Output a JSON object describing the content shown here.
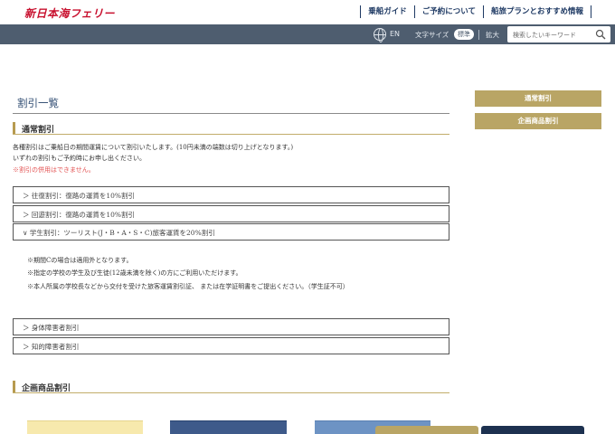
{
  "header": {
    "logo": "新日本海フェリー",
    "nav": [
      "乗船ガイド",
      "ご予約について",
      "船旅プランとおすすめ情報"
    ],
    "lang": "EN",
    "font_size_label": "文字サイズ",
    "font_standard": "標準",
    "font_large": "拡大",
    "search_placeholder": "検索したいキーワード"
  },
  "main": {
    "page_title": "割引一覧",
    "section1_title": "通常割引",
    "intro_line1": "各種割引はご乗船日の期間運賃について割引いたします。(10円未満の端数は切り上げとなります。)",
    "intro_line2": "いずれの割引もご予約時にお申し出ください。",
    "intro_warning": "※割引の併用はできません。",
    "accordion": [
      "＞ 往復割引：復路の運賃を10%割引",
      "＞ 回遊割引：復路の運賃を10%割引",
      "∨ 学生割引：ツーリスト(J・B・A・S・C)旅客運賃を20%割引",
      "＞ 身体障害者割引",
      "＞ 知的障害者割引"
    ],
    "student_notes": [
      "※期間Cの場合は適用外となります。",
      "※指定の学校の学生及び生徒(12歳未満を除く)の方にご利用いただけます。"
    ],
    "student_warning": "※本人所属の学校長などから交付を受けた旅客運賃割引証、 または在学証明書をご提出ください。（学生証不可）",
    "section2_title": "企画商品割引"
  },
  "sidebar": {
    "buttons": [
      "通常割引",
      "企画商品割引"
    ]
  }
}
